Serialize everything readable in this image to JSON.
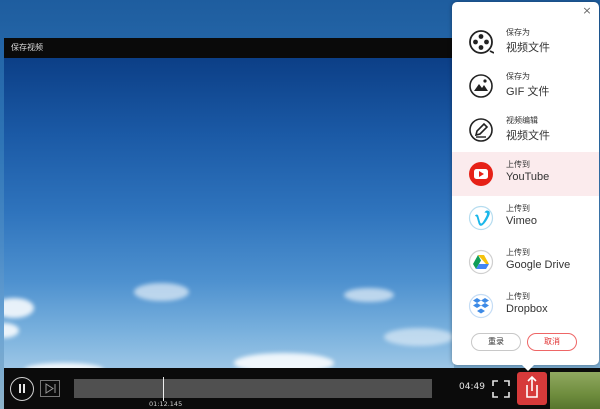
{
  "window": {
    "title": "保存视频"
  },
  "playback": {
    "current_time": "01:12.145",
    "duration": "04:49"
  },
  "share_panel": {
    "options": [
      {
        "small": "保存为",
        "large": "视频文件",
        "icon": "film-reel-icon"
      },
      {
        "small": "保存为",
        "large": "GIF 文件",
        "icon": "gif-image-icon"
      },
      {
        "small": "视频编辑",
        "large": "视频文件",
        "icon": "edit-pen-icon"
      },
      {
        "small": "上传到",
        "large": "YouTube",
        "icon": "youtube-icon",
        "active": true
      },
      {
        "small": "上传到",
        "large": "Vimeo",
        "icon": "vimeo-icon"
      },
      {
        "small": "上传到",
        "large": "Google Drive",
        "icon": "google-drive-icon"
      },
      {
        "small": "上传到",
        "large": "Dropbox",
        "icon": "dropbox-icon"
      }
    ],
    "reset_label": "重录",
    "cancel_label": "取消",
    "close_glyph": "×"
  },
  "colors": {
    "accent": "#e03030",
    "youtube_red": "#e62117",
    "vimeo_blue": "#1ab7ea",
    "dropbox_blue": "#3d8ae6"
  }
}
